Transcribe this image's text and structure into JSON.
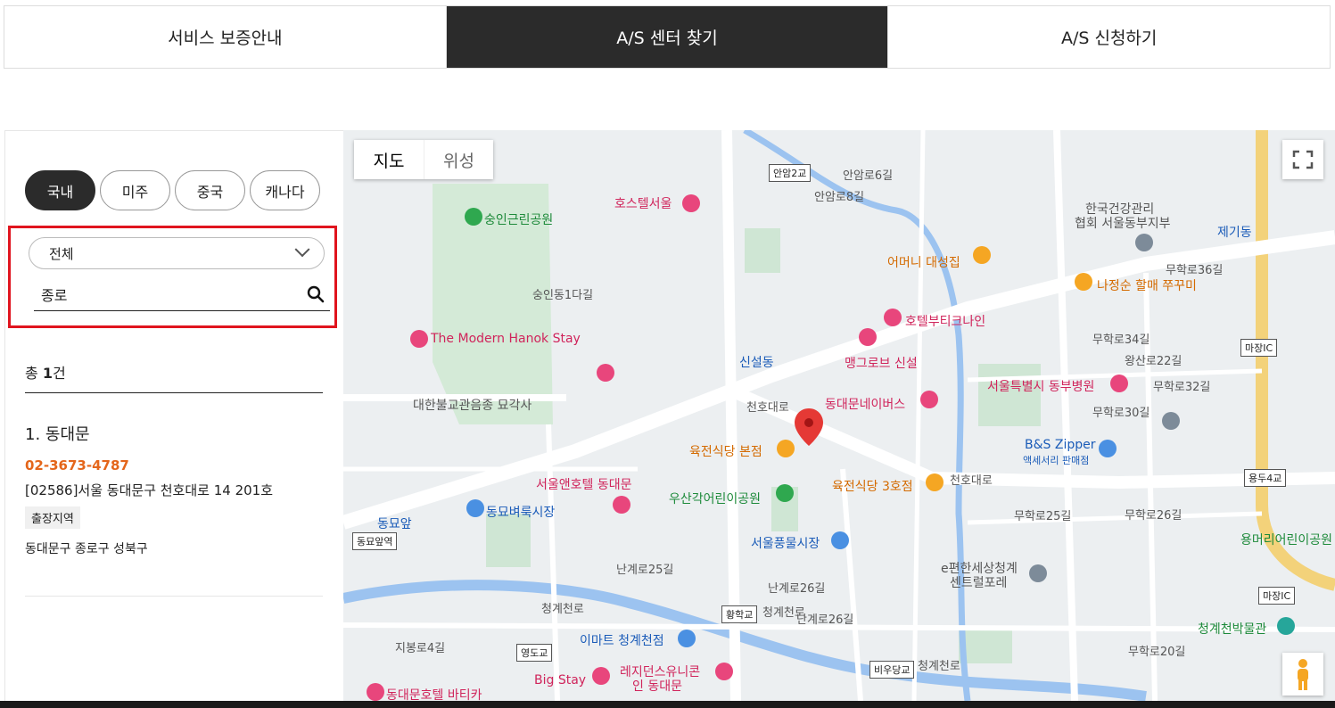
{
  "tabs": [
    {
      "label": "서비스 보증안내",
      "active": false
    },
    {
      "label": "A/S 센터 찾기",
      "active": true
    },
    {
      "label": "A/S 신청하기",
      "active": false
    }
  ],
  "regions": [
    {
      "label": "국내",
      "active": true
    },
    {
      "label": "미주",
      "active": false
    },
    {
      "label": "중국",
      "active": false
    },
    {
      "label": "캐나다",
      "active": false
    }
  ],
  "filter": {
    "selected": "전체",
    "search_value": "종로"
  },
  "result_count": {
    "prefix": "총 ",
    "count": "1",
    "suffix": "건"
  },
  "results": [
    {
      "name": "1. 동대문",
      "phone": "02-3673-4787",
      "address": "[02586]서울 동대문구 천호대로 14 201호",
      "badge": "출장지역",
      "areas": "동대문구 종로구 성북구"
    }
  ],
  "map": {
    "toggle": [
      "지도",
      "위성"
    ],
    "labels": {
      "hostel_seoul": "호스텔서울",
      "sungin_park": "숭인근린공원",
      "korea_health": "한국건강관리",
      "korea_health2": "협회 서울동부지부",
      "jegi": "제기동",
      "mother": "어머니 대성집",
      "najeongsun": "나정순 할매 쭈꾸미",
      "hotel_butique": "호텔부티크나인",
      "modern_hanok": "The Modern Hanok Stay",
      "sinseol": "신설동",
      "mangrove": "맹그로브 신설",
      "dongbu_hosp": "서울특별시 동부병원",
      "dongdaemun_inn": "동대문네이버스",
      "temple": "대한불교관음종 묘각사",
      "yukjeon1": "육전식당 본점",
      "bs_zipper": "B&S Zipper",
      "bs_zipper2": "액세서리 판매점",
      "seoul_and": "서울앤호텔 동대문",
      "usan_park": "우산각어린이공원",
      "yukjeon3": "육전식당 3호점",
      "dongmyo_market": "동묘벼룩시장",
      "dongmyo": "동묘앞",
      "pungmul": "서울풍물시장",
      "epyeonhan": "e편한세상청계",
      "epyeonhan2": "센트럴포레",
      "yongmeori": "용머리어린이공원",
      "cheonggye_museum": "청계천박물관",
      "emart": "이마트 청계천점",
      "bigstay": "Big Stay",
      "residence": "레지던스유니콘",
      "residence2": "인 동대문",
      "dongdaemun_hotel": "동대문호텔 바티카"
    },
    "roads": {
      "cheonho1": "천호대로",
      "cheonho2": "천호대로",
      "cheonggye1": "청계천로",
      "cheonggye2": "청계천로",
      "cheonggye3": "청계천로",
      "nangye25": "난계로25길",
      "nangye26": "난계로26길",
      "nangye26b": "난계로26길",
      "muhak25": "무학로25길",
      "muhak26": "무학로26길",
      "muhak30": "무학로30길",
      "muhak32": "무학로32길",
      "muhak34": "무학로34길",
      "muhak36": "무학로36길",
      "wangsan22": "왕산로22길",
      "muhak20": "무학로20길",
      "jibong4": "지봉로4길",
      "sungin1da": "숭인동1다길",
      "anam6": "안암로6길",
      "anam8": "안암로8길"
    },
    "boxes": {
      "anam2": "안암2교",
      "dongmyo_box": "동묘앞역",
      "hwanghak": "황학교",
      "yeongdo": "영도교",
      "biudang": "비우당교",
      "majang1": "마장IC",
      "majang2": "마장IC",
      "yongdu4": "용두4교"
    }
  }
}
